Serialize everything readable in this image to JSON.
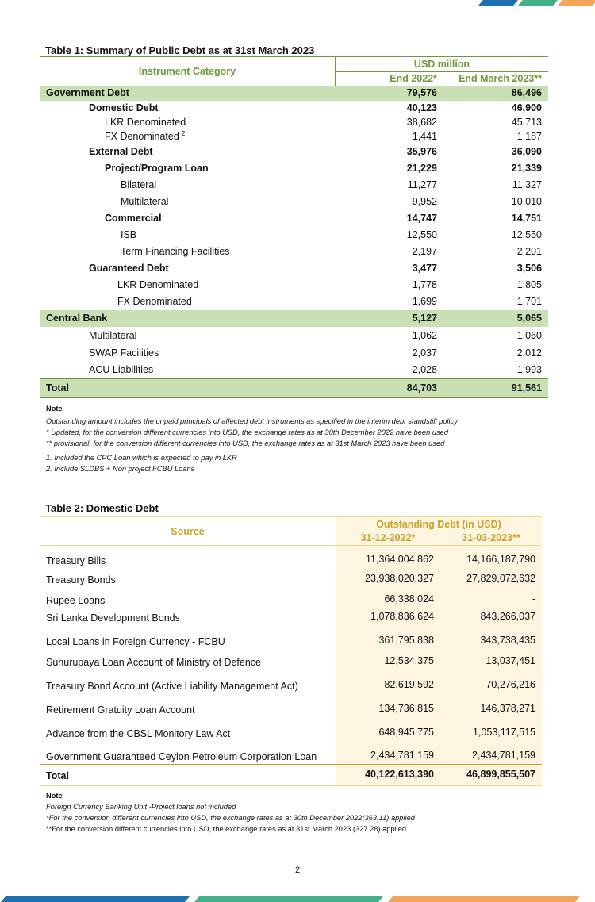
{
  "table1": {
    "title": "Table 1: Summary of Public Debt as at 31st March 2023",
    "header": {
      "category": "Instrument Category",
      "unit": "USD million",
      "col1": "End 2022*",
      "col2": "End March 2023**"
    },
    "rows": [
      {
        "label": "Government Debt",
        "v1": "79,576",
        "v2": "86,496",
        "level": 0,
        "style": "section"
      },
      {
        "label": "Domestic Debt",
        "v1": "40,123",
        "v2": "46,900",
        "level": 1,
        "style": "bold"
      },
      {
        "label": "LKR Denominated",
        "sup": "1",
        "v1": "38,682",
        "v2": "45,713",
        "level": 2,
        "style": "normal"
      },
      {
        "label": "FX Denominated",
        "sup": "2",
        "v1": "1,441",
        "v2": "1,187",
        "level": 2,
        "style": "normal"
      },
      {
        "label": "External Debt",
        "v1": "35,976",
        "v2": "36,090",
        "level": 1,
        "style": "bold"
      },
      {
        "label": "Project/Program Loan",
        "v1": "21,229",
        "v2": "21,339",
        "level": 2,
        "style": "bold"
      },
      {
        "label": "Bilateral",
        "v1": "11,277",
        "v2": "11,327",
        "level": 3,
        "style": "normal"
      },
      {
        "label": "Multilateral",
        "v1": "9,952",
        "v2": "10,010",
        "level": 3,
        "style": "normal"
      },
      {
        "label": "Commercial",
        "v1": "14,747",
        "v2": "14,751",
        "level": 2,
        "style": "bold"
      },
      {
        "label": "ISB",
        "v1": "12,550",
        "v2": "12,550",
        "level": 3,
        "style": "normal"
      },
      {
        "label": "Term Financing Facilities",
        "v1": "2,197",
        "v2": "2,201",
        "level": 3,
        "style": "normal"
      },
      {
        "label": "Guaranteed Debt",
        "v1": "3,477",
        "v2": "3,506",
        "level": 1,
        "style": "bold"
      },
      {
        "label": "LKR Denominated",
        "v1": "1,778",
        "v2": "1,805",
        "level": 4,
        "style": "normal"
      },
      {
        "label": "FX Denominated",
        "v1": "1,699",
        "v2": "1,701",
        "level": 4,
        "style": "normal"
      },
      {
        "label": "Central Bank",
        "v1": "5,127",
        "v2": "5,065",
        "level": 0,
        "style": "section"
      },
      {
        "label": "Multilateral",
        "v1": "1,062",
        "v2": "1,060",
        "level": 1,
        "style": "normal"
      },
      {
        "label": "SWAP Facilities",
        "v1": "2,037",
        "v2": "2,012",
        "level": 1,
        "style": "normal"
      },
      {
        "label": "ACU Liabilities",
        "v1": "2,028",
        "v2": "1,993",
        "level": 1,
        "style": "normal"
      },
      {
        "label": "Total",
        "v1": "84,703",
        "v2": "91,561",
        "level": 0,
        "style": "section"
      }
    ],
    "note_label": "Note",
    "notes": [
      "Outstanding amount includes the unpaid principals of affected debt instruments as specified in the  interim debt standstill policy",
      "* Updated, for the  conversion  different currencies into USD, the exchange rates as at 30th December 2022 have been used",
      "** provisional, for the  conversion  different currencies into USD, the exchange rates as at 31st March 2023 have been used"
    ],
    "footnotes": [
      "1. Included the CPC Loan which is expected to pay in LKR",
      "2.  Include SLDBS + Non project FCBU Loans"
    ]
  },
  "table2": {
    "title": "Table 2: Domestic Debt",
    "header": {
      "source": "Source",
      "group": "Outstanding Debt (in USD)",
      "col1": "31-12-2022*",
      "col2": "31-03-2023**"
    },
    "rows": [
      {
        "label": "Treasury Bills",
        "v1": "11,364,004,862",
        "v2": "14,166,187,790"
      },
      {
        "label": "Treasury Bonds",
        "v1": "23,938,020,327",
        "v2": "27,829,072,632"
      },
      {
        "label": "Rupee Loans",
        "v1": "66,338,024",
        "v2": "-"
      },
      {
        "label": "Sri Lanka Development Bonds",
        "v1": "1,078,836,624",
        "v2": "843,266,037"
      },
      {
        "label": "Local Loans in Foreign Currency - FCBU",
        "v1": "361,795,838",
        "v2": "343,738,435"
      },
      {
        "label": "Suhurupaya Loan Account of Ministry of Defence",
        "v1": "12,534,375",
        "v2": "13,037,451"
      },
      {
        "label": "Treasury Bond Account (Active Liability Management Act)",
        "v1": "82,619,592",
        "v2": "70,276,216"
      },
      {
        "label": "Retirement Gratuity Loan Account",
        "v1": "134,736,815",
        "v2": "146,378,271"
      },
      {
        "label": "Advance from the CBSL Monitory Law Act",
        "v1": "648,945,775",
        "v2": "1,053,117,515"
      },
      {
        "label": "Government Guaranteed Ceylon Petroleum Corporation Loan",
        "v1": "2,434,781,159",
        "v2": "2,434,781,159"
      }
    ],
    "total": {
      "label": "Total",
      "v1": "40,122,613,390",
      "v2": "46,899,855,507"
    },
    "note_label": "Note",
    "notes": [
      "Foreign Currency Banking Unit -Project loans not included",
      "*For the conversion  different currencies into USD, the exchange rates as at 30th  December 2022(363.11) applied",
      "**For the conversion  different currencies into USD, the exchange rates as at 31st March 2023 (327.28) applied"
    ]
  },
  "page_number": "2",
  "colors": {
    "blue": "#1d6fb0",
    "green": "#44b08a",
    "orange": "#f3a65a",
    "table1_header": "#6e9a3c",
    "table2_header": "#c9a227"
  }
}
